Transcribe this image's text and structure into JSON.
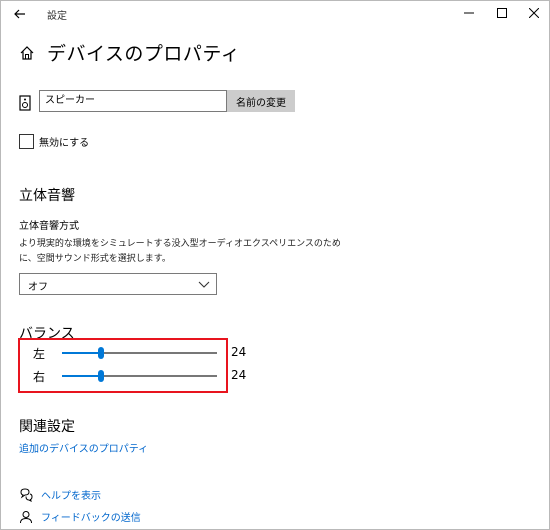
{
  "window": {
    "title": "設定"
  },
  "header": {
    "page_title": "デバイスのプロパティ"
  },
  "device": {
    "name_value": "スピーカー",
    "rename_button": "名前の変更",
    "disable_label": "無効にする",
    "disable_checked": false
  },
  "spatial": {
    "heading": "立体音響",
    "format_label": "立体音響方式",
    "description": "より現実的な環境をシミュレートする没入型オーディオエクスペリエンスのために、空間サウンド形式を選択します。",
    "selected": "オフ"
  },
  "balance": {
    "heading": "バランス",
    "channels": [
      {
        "label": "左",
        "value": "24",
        "level_percent": 24
      },
      {
        "label": "右",
        "value": "24",
        "level_percent": 24
      }
    ],
    "accent_color": "#0078d7",
    "highlight_color": "#e8141e"
  },
  "related": {
    "heading": "関連設定",
    "link": "追加のデバイスのプロパティ"
  },
  "footer": {
    "help": "ヘルプを表示",
    "feedback": "フィードバックの送信"
  }
}
